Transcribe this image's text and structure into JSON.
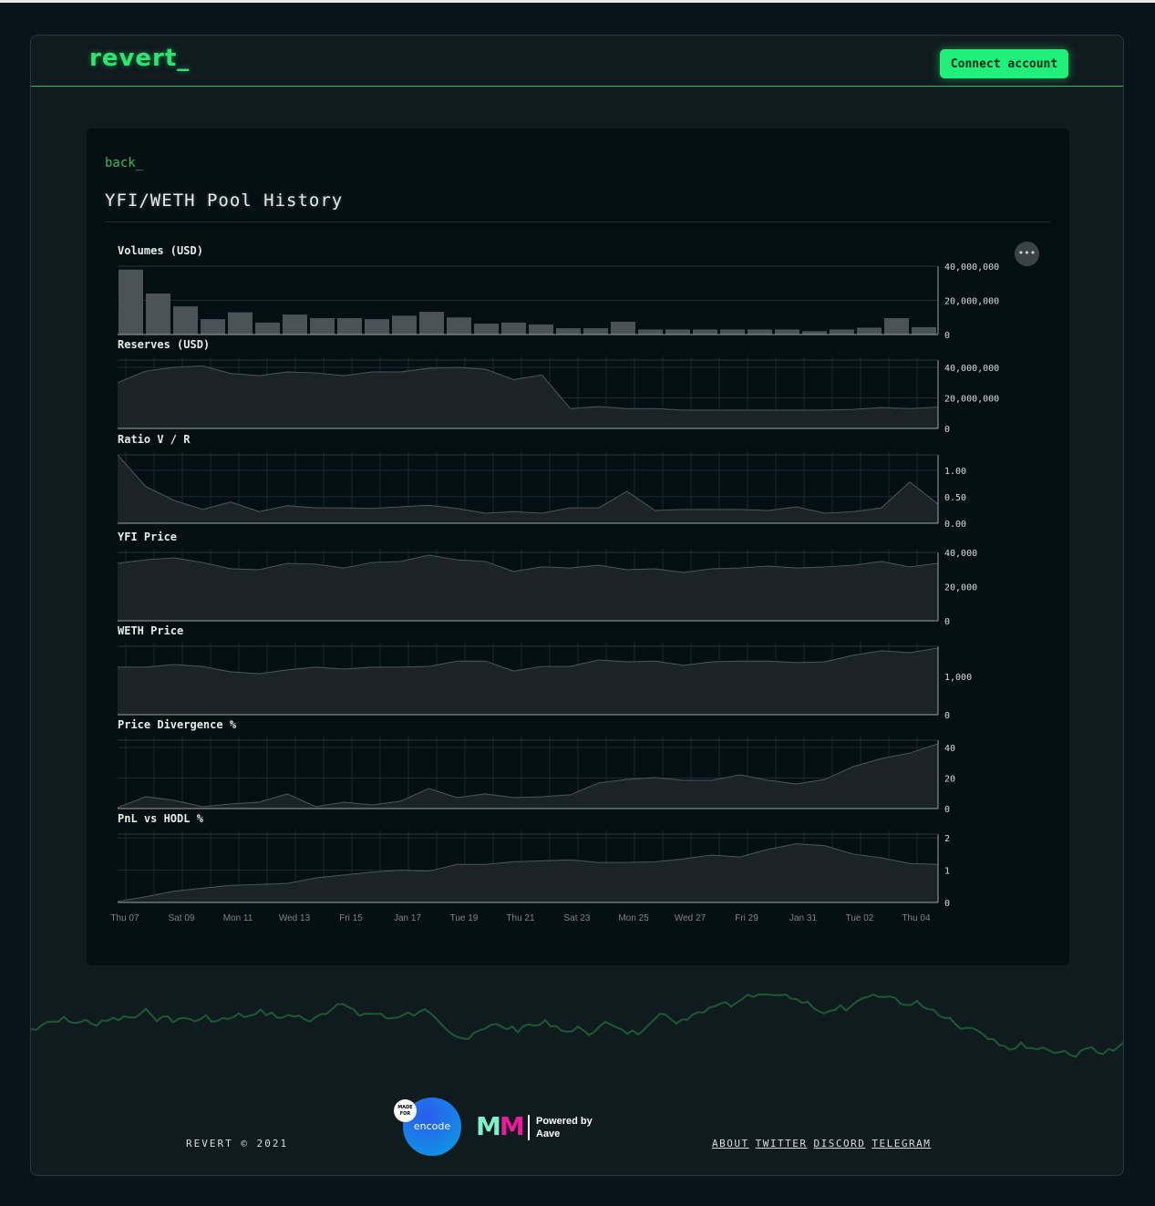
{
  "header": {
    "logo": "revert_",
    "connect_label": "Connect account"
  },
  "page": {
    "back_label": "back_",
    "title": "YFI/WETH Pool History",
    "menu_icon": "more-horizontal-icon",
    "menu_label": "•••"
  },
  "colors": {
    "accent": "#1ef07a",
    "fill": "#1b2327",
    "stroke": "#4d565b",
    "bar": "#4a5358",
    "wave": "#1d5a30"
  },
  "x_labels": [
    "Thu 07",
    "Sat 09",
    "Mon 11",
    "Wed 13",
    "Fri 15",
    "Jan 17",
    "Tue 19",
    "Thu 21",
    "Sat 23",
    "Mon 25",
    "Wed 27",
    "Fri 29",
    "Jan 31",
    "Tue 02",
    "Thu 04"
  ],
  "chart_data": [
    {
      "type": "bar",
      "title": "Volumes (USD)",
      "ylim": [
        0,
        40000000
      ],
      "yticks": [
        0,
        20000000,
        40000000
      ],
      "ytick_labels": [
        "0",
        "20,000,000",
        "40,000,000"
      ],
      "values": [
        38000000,
        24000000,
        16500000,
        9000000,
        13000000,
        7000000,
        11700000,
        9600000,
        9600000,
        9000000,
        11000000,
        13300000,
        10000000,
        6400000,
        7000000,
        5900000,
        3700000,
        3700000,
        7500000,
        3000000,
        3000000,
        3000000,
        3000000,
        3000000,
        3000000,
        2000000,
        3000000,
        4000000,
        9600000,
        4300000
      ]
    },
    {
      "type": "area",
      "title": "Reserves (USD)",
      "ylim": [
        0,
        44800000
      ],
      "yticks": [
        0,
        20000000,
        40000000
      ],
      "ytick_labels": [
        "0",
        "20,000,000",
        "40,000,000"
      ],
      "values": [
        30000000,
        37600000,
        40000000,
        41000000,
        36000000,
        34600000,
        37000000,
        36400000,
        34600000,
        37000000,
        37000000,
        39400000,
        40000000,
        38800000,
        32000000,
        35000000,
        13000000,
        14300000,
        13000000,
        13000000,
        12000000,
        12000000,
        12000000,
        12000000,
        12000000,
        12000000,
        12500000,
        13700000,
        13000000,
        14000000
      ]
    },
    {
      "type": "area",
      "title": "Ratio V / R",
      "ylim": [
        0,
        1.29
      ],
      "yticks": [
        0,
        0.5,
        1
      ],
      "ytick_labels": [
        "0.00",
        "0.50",
        "1.00"
      ],
      "values": [
        1.29,
        0.69,
        0.43,
        0.26,
        0.4,
        0.22,
        0.33,
        0.29,
        0.29,
        0.28,
        0.31,
        0.34,
        0.28,
        0.19,
        0.22,
        0.19,
        0.29,
        0.29,
        0.6,
        0.24,
        0.26,
        0.26,
        0.26,
        0.24,
        0.31,
        0.19,
        0.22,
        0.29,
        0.78,
        0.36
      ]
    },
    {
      "type": "area",
      "title": "YFI Price",
      "ylim": [
        0,
        40000
      ],
      "yticks": [
        0,
        20000,
        40000
      ],
      "ytick_labels": [
        "0",
        "20,000",
        "40,000"
      ],
      "values": [
        33600,
        35700,
        36800,
        34100,
        30400,
        29900,
        33600,
        33100,
        30900,
        34100,
        34700,
        38400,
        35700,
        34700,
        28800,
        31500,
        30900,
        32500,
        29900,
        30400,
        28300,
        30400,
        30900,
        32000,
        30900,
        31500,
        32500,
        34700,
        31500,
        33600
      ]
    },
    {
      "type": "area",
      "title": "WETH Price",
      "ylim": [
        0,
        1786
      ],
      "yticks": [
        0,
        1000
      ],
      "ytick_labels": [
        "0",
        "1,000"
      ],
      "values": [
        1240,
        1240,
        1310,
        1260,
        1120,
        1070,
        1170,
        1240,
        1190,
        1240,
        1240,
        1260,
        1400,
        1400,
        1140,
        1260,
        1260,
        1430,
        1380,
        1400,
        1290,
        1380,
        1400,
        1400,
        1360,
        1380,
        1550,
        1670,
        1620,
        1740
      ]
    },
    {
      "type": "area",
      "title": "Price Divergence %",
      "ylim": [
        0,
        44.8
      ],
      "yticks": [
        0,
        20,
        40
      ],
      "ytick_labels": [
        "0",
        "20",
        "40"
      ],
      "values": [
        0.6,
        7.8,
        5.4,
        1.2,
        3,
        4.2,
        9.6,
        1.2,
        4.2,
        2.4,
        4.8,
        13.1,
        7.2,
        9.6,
        7.2,
        7.8,
        9,
        16.7,
        19.1,
        20.3,
        18.5,
        18.5,
        22.1,
        18.5,
        16.1,
        19.1,
        27.5,
        32.8,
        36.4,
        42.4
      ]
    },
    {
      "type": "area",
      "title": "PnL vs HODL %",
      "ylim": [
        0,
        2.12
      ],
      "yticks": [
        0,
        1,
        2
      ],
      "ytick_labels": [
        "0",
        "1",
        "2"
      ],
      "values": [
        0.03,
        0.18,
        0.35,
        0.44,
        0.53,
        0.56,
        0.59,
        0.76,
        0.85,
        0.94,
        1.0,
        0.97,
        1.18,
        1.18,
        1.26,
        1.29,
        1.32,
        1.24,
        1.24,
        1.26,
        1.35,
        1.47,
        1.41,
        1.65,
        1.82,
        1.76,
        1.5,
        1.38,
        1.21,
        1.18
      ]
    }
  ],
  "footer": {
    "copyright": "REVERT © 2021",
    "encode_label": "encode",
    "made_for": "MADE FOR",
    "mm_a": "M",
    "mm_b": "M",
    "powered": "Powered by",
    "powered_by": "Aave",
    "links": [
      "ABOUT",
      "TWITTER",
      "DISCORD",
      "TELEGRAM"
    ]
  }
}
